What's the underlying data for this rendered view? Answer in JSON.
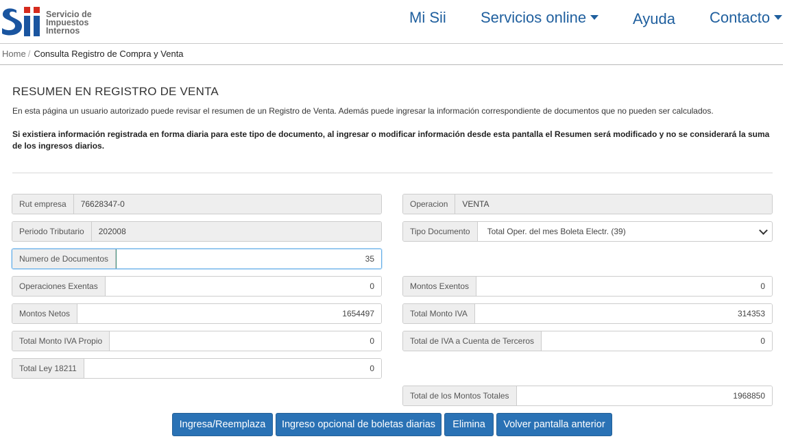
{
  "logo": {
    "line1": "Servicio de",
    "line2": "Impuestos",
    "line3": "Internos"
  },
  "nav": {
    "mi_sii": "Mi Sii",
    "servicios": "Servicios online",
    "ayuda": "Ayuda",
    "contacto": "Contacto"
  },
  "breadcrumb": {
    "home": "Home",
    "separator": "/",
    "current": "Consulta Registro de Compra y Venta"
  },
  "page": {
    "title": "RESUMEN EN REGISTRO DE VENTA",
    "intro": "En esta página un usuario autorizado puede revisar el resumen de un Registro de Venta. Además puede ingresar la información correspondiente de documentos que no pueden ser calculados.",
    "warning": "Si existiera información registrada en forma diaria para este tipo de documento, al ingresar o modificar información desde esta pantalla el Resumen será modificado y no se considerará la suma de los ingresos diarios."
  },
  "form": {
    "rut_empresa": {
      "label": "Rut empresa",
      "value": "76628347-0"
    },
    "operacion": {
      "label": "Operacion",
      "value": "VENTA"
    },
    "periodo": {
      "label": "Periodo Tributario",
      "value": "202008"
    },
    "tipo_documento": {
      "label": "Tipo Documento",
      "value": "Total Oper. del mes Boleta Electr. (39)"
    },
    "numero_documentos": {
      "label": "Numero de Documentos",
      "value": "35"
    },
    "operaciones_exentas": {
      "label": "Operaciones Exentas",
      "value": "0"
    },
    "montos_exentos": {
      "label": "Montos Exentos",
      "value": "0"
    },
    "montos_netos": {
      "label": "Montos Netos",
      "value": "1654497"
    },
    "total_monto_iva": {
      "label": "Total Monto IVA",
      "value": "314353"
    },
    "total_iva_propio": {
      "label": "Total Monto IVA Propio",
      "value": "0"
    },
    "total_iva_terceros": {
      "label": "Total de IVA a Cuenta de Terceros",
      "value": "0"
    },
    "total_ley": {
      "label": "Total Ley 18211",
      "value": "0"
    },
    "total_montos_totales": {
      "label": "Total de los Montos Totales",
      "value": "1968850"
    }
  },
  "buttons": {
    "ingresa": "Ingresa/Reemplaza",
    "boletas": "Ingreso opcional de boletas diarias",
    "elimina": "Elimina",
    "volver": "Volver pantalla anterior"
  },
  "colors": {
    "brand_blue": "#1f5f9e",
    "logo_blue": "#1a55a0",
    "logo_red": "#d52b1e",
    "button_blue": "#2a72b5"
  }
}
